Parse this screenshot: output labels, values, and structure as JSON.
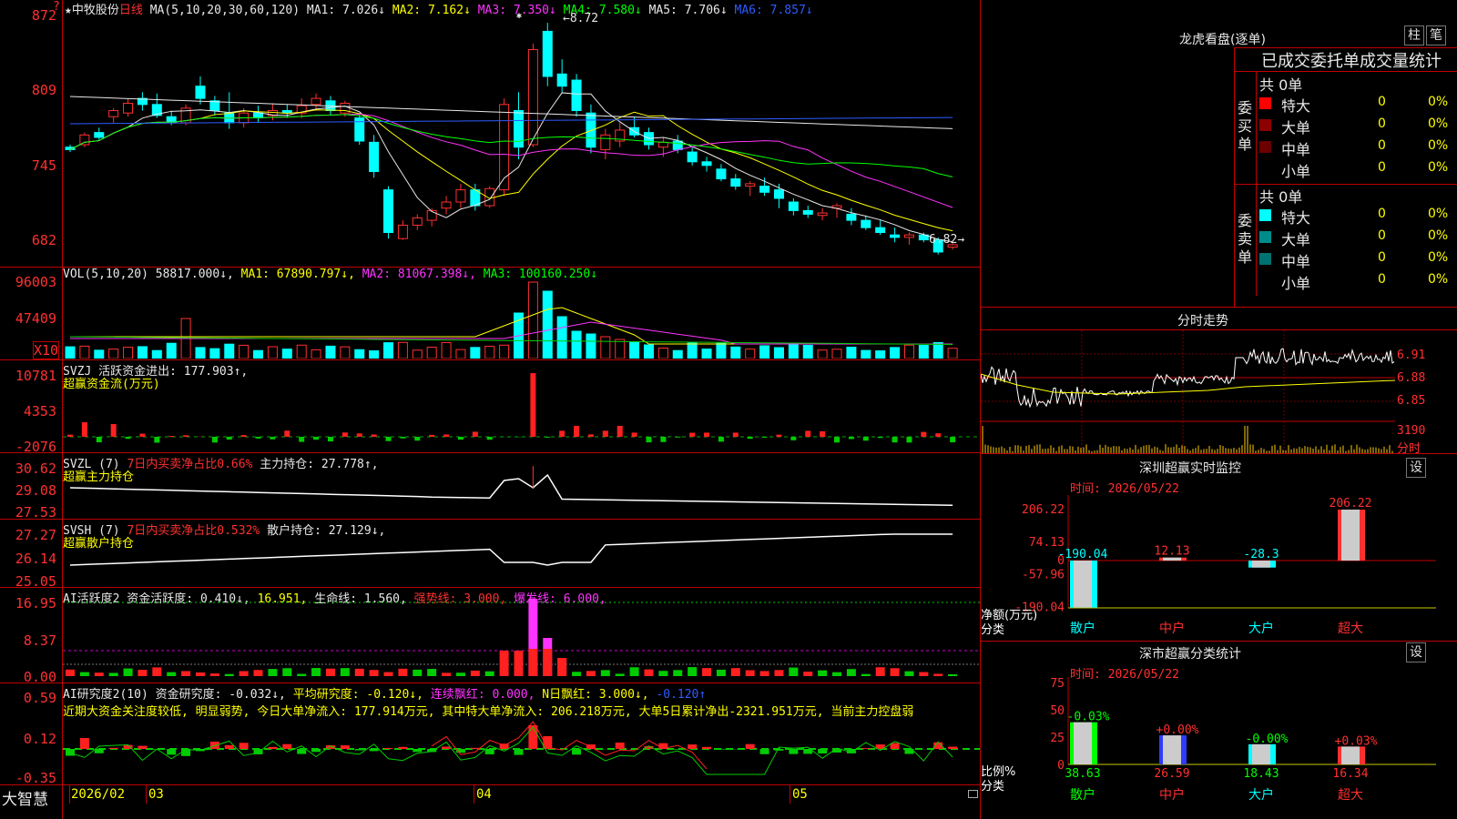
{
  "stock": {
    "star": "★",
    "name": "中牧股份",
    "period": "日线",
    "ma_label": "MA(5,10,20,30,60,120)",
    "ma1": "MA1: 7.026↓",
    "ma2": "MA2: 7.162↓",
    "ma3": "MA3: 7.350↓",
    "ma4": "MA4: 7.580↓",
    "ma5": "MA5: 7.706↓",
    "ma6": "MA6: 7.857↓",
    "high_mark": "8.72",
    "low_mark": "6.82",
    "help": "?"
  },
  "price_axis": [
    "872",
    "809",
    "745",
    "682"
  ],
  "volume": {
    "label": "VOL(5,10,20)",
    "v": "58817.000↓,",
    "ma1": "MA1: 67890.797↓,",
    "ma2": "MA2: 81067.398↓,",
    "ma3": "MA3: 100160.250↓",
    "axis": [
      "96003",
      "47409",
      "X10"
    ]
  },
  "svzj": {
    "label": "SVZJ  活跃资金进出: 177.903↑,",
    "sub": "超赢资金流(万元)",
    "axis": [
      "10781",
      "4353",
      "-2076"
    ]
  },
  "svzl": {
    "label": "SVZL (7)",
    "ratio": "7日内买卖净占比0.66%",
    "hold": "主力持仓: 27.778↑,",
    "sub": "超赢主力持仓",
    "axis": [
      "30.62",
      "29.08",
      "27.53"
    ]
  },
  "svsh": {
    "label": "SVSH (7)",
    "ratio": "7日内买卖净占比0.532%",
    "hold": "散户持仓: 27.129↓,",
    "sub": "超赢散户持仓",
    "axis": [
      "27.27",
      "26.14",
      "25.05"
    ]
  },
  "ai1": {
    "label": "AI活跃度2 资金活跃度: 0.410↓,",
    "v2": "16.951,",
    "life": "生命线: 1.560,",
    "strong": "强势线: 3.000,",
    "burst": "爆发线: 6.000,",
    "axis": [
      "16.95",
      "8.37",
      "0.00"
    ]
  },
  "ai2": {
    "label": "AI研究度2(10) 资金研究度: -0.032↓,",
    "avg": "平均研究度: -0.120↓,",
    "cont": "连续飘红: 0.000,",
    "nday": "N日飘红: 3.000↓,",
    "last": "-0.120↑",
    "comment": "近期大资金关注度较低, 明显弱势, 今日大单净流入: 177.914万元, 其中特大单净流入: 206.218万元, 大单5日累计净出-2321.951万元, 当前主力控盘弱",
    "axis": [
      "0.59",
      "0.12",
      "-0.35"
    ]
  },
  "date_axis": [
    "2026/02",
    "03",
    "04",
    "05"
  ],
  "brand": "大智慧",
  "right": {
    "lhb_title": "龙虎看盘(逐单)",
    "btn_column": "柱",
    "btn_pen": "笔",
    "stat_header": "已成交委托单成交量统计",
    "buy_side": "委买单",
    "sell_side": "委卖单",
    "buy_total": "共 0单",
    "sell_total": "共 0单",
    "buy_rows": [
      {
        "label": "特大",
        "n": "0",
        "p": "0%",
        "color": "#ff0000"
      },
      {
        "label": "大单",
        "n": "0",
        "p": "0%",
        "color": "#8b0000"
      },
      {
        "label": "中单",
        "n": "0",
        "p": "0%",
        "color": "#6a0000"
      },
      {
        "label": "小单",
        "n": "0",
        "p": "0%",
        "color": ""
      }
    ],
    "sell_rows": [
      {
        "label": "特大",
        "n": "0",
        "p": "0%",
        "color": "#00ffff"
      },
      {
        "label": "大单",
        "n": "0",
        "p": "0%",
        "color": "#008b8b"
      },
      {
        "label": "中单",
        "n": "0",
        "p": "0%",
        "color": "#007070"
      },
      {
        "label": "小单",
        "n": "0",
        "p": "0%",
        "color": ""
      }
    ],
    "intraday_title": "分时走势",
    "intraday_axis": [
      "6.91",
      "6.88",
      "6.85",
      "3190",
      "分时"
    ],
    "sz_title": "深圳超赢实时监控",
    "sz_btn": "设",
    "sz_time": "时间: 2026/05/22",
    "sz_axis": [
      "206.22",
      "74.13",
      "0",
      "-57.96",
      "-190.04"
    ],
    "sz_ylabel": "净额(万元)",
    "sz_xlabel": "分类",
    "sz_values": [
      "-190.04",
      "12.13",
      "-28.3",
      "206.22"
    ],
    "categories": [
      "散户",
      "中户",
      "大户",
      "超大"
    ],
    "cls_title": "深市超赢分类统计",
    "cls_btn": "设",
    "cls_time": "时间: 2026/05/22",
    "cls_axis": [
      "75",
      "50",
      "25",
      "0"
    ],
    "cls_ylabel": "比例%",
    "cls_xlabel": "分类",
    "cls_top": [
      "-0.03%",
      "+0.00%",
      "-0.00%",
      "+0.03%"
    ],
    "cls_values": [
      "38.63",
      "26.59",
      "18.43",
      "16.34"
    ]
  },
  "chart_data": {
    "type": "candlestick",
    "x_range": [
      "2026/02",
      "2026/05/22"
    ],
    "price_range": [
      6.82,
      8.72
    ],
    "candles": [
      [
        7.7,
        7.72,
        7.66,
        7.68
      ],
      [
        7.72,
        7.82,
        7.7,
        7.8
      ],
      [
        7.82,
        7.86,
        7.76,
        7.78
      ],
      [
        7.95,
        8.02,
        7.9,
        8.0
      ],
      [
        7.98,
        8.1,
        7.95,
        8.06
      ],
      [
        8.1,
        8.15,
        8.0,
        8.05
      ],
      [
        8.05,
        8.14,
        7.94,
        7.96
      ],
      [
        7.95,
        8.0,
        7.88,
        7.9
      ],
      [
        7.9,
        8.05,
        7.88,
        8.02
      ],
      [
        8.2,
        8.28,
        8.05,
        8.1
      ],
      [
        8.08,
        8.12,
        7.96,
        8.0
      ],
      [
        7.98,
        8.15,
        7.85,
        7.9
      ],
      [
        7.9,
        8.02,
        7.86,
        7.98
      ],
      [
        7.98,
        8.04,
        7.9,
        7.94
      ],
      [
        7.96,
        8.06,
        7.92,
        8.0
      ],
      [
        8.0,
        8.05,
        7.94,
        7.98
      ],
      [
        7.98,
        8.1,
        7.94,
        8.04
      ],
      [
        8.05,
        8.14,
        8.0,
        8.1
      ],
      [
        8.08,
        8.12,
        7.96,
        8.0
      ],
      [
        7.98,
        8.08,
        7.95,
        8.06
      ],
      [
        7.94,
        7.98,
        7.72,
        7.75
      ],
      [
        7.74,
        7.8,
        7.45,
        7.5
      ],
      [
        7.35,
        7.38,
        6.95,
        7.0
      ],
      [
        6.95,
        7.1,
        6.94,
        7.06
      ],
      [
        7.06,
        7.15,
        7.02,
        7.12
      ],
      [
        7.1,
        7.2,
        7.05,
        7.18
      ],
      [
        7.2,
        7.3,
        7.15,
        7.25
      ],
      [
        7.25,
        7.4,
        7.2,
        7.35
      ],
      [
        7.35,
        7.4,
        7.18,
        7.22
      ],
      [
        7.22,
        7.38,
        7.2,
        7.36
      ],
      [
        7.35,
        8.1,
        7.3,
        8.05
      ],
      [
        8.0,
        8.15,
        7.6,
        7.7
      ],
      [
        7.72,
        8.55,
        7.7,
        8.5
      ],
      [
        8.65,
        8.72,
        8.2,
        8.28
      ],
      [
        8.3,
        8.42,
        8.15,
        8.2
      ],
      [
        8.25,
        8.3,
        7.95,
        8.0
      ],
      [
        7.98,
        8.05,
        7.65,
        7.7
      ],
      [
        7.68,
        7.85,
        7.6,
        7.8
      ],
      [
        7.75,
        7.9,
        7.7,
        7.84
      ],
      [
        7.86,
        7.95,
        7.78,
        7.8
      ],
      [
        7.82,
        7.86,
        7.68,
        7.72
      ],
      [
        7.7,
        7.78,
        7.62,
        7.74
      ],
      [
        7.75,
        7.8,
        7.65,
        7.68
      ],
      [
        7.66,
        7.7,
        7.55,
        7.58
      ],
      [
        7.58,
        7.62,
        7.5,
        7.55
      ],
      [
        7.52,
        7.56,
        7.42,
        7.44
      ],
      [
        7.44,
        7.48,
        7.35,
        7.38
      ],
      [
        7.38,
        7.42,
        7.3,
        7.4
      ],
      [
        7.38,
        7.45,
        7.3,
        7.33
      ],
      [
        7.35,
        7.4,
        7.2,
        7.28
      ],
      [
        7.25,
        7.28,
        7.14,
        7.18
      ],
      [
        7.18,
        7.22,
        7.12,
        7.15
      ],
      [
        7.14,
        7.2,
        7.1,
        7.16
      ],
      [
        7.2,
        7.24,
        7.12,
        7.22
      ],
      [
        7.15,
        7.2,
        7.06,
        7.1
      ],
      [
        7.1,
        7.14,
        7.02,
        7.04
      ],
      [
        7.04,
        7.1,
        6.98,
        7.0
      ],
      [
        6.98,
        7.04,
        6.92,
        6.96
      ],
      [
        6.96,
        7.0,
        6.9,
        6.98
      ],
      [
        6.98,
        7.0,
        6.92,
        6.94
      ],
      [
        6.94,
        6.96,
        6.82,
        6.84
      ],
      [
        6.88,
        6.92,
        6.86,
        6.9
      ]
    ]
  }
}
